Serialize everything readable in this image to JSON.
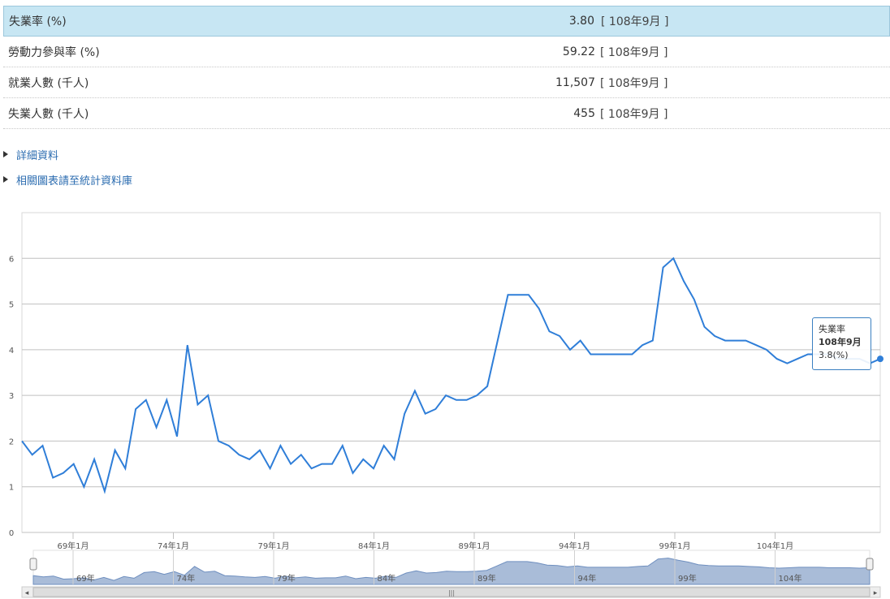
{
  "stats": [
    {
      "label": "失業率 (%)",
      "value": "3.80",
      "period": "[ 108年9月 ]",
      "highlight": true
    },
    {
      "label": "勞動力參與率 (%)",
      "value": "59.22",
      "period": "[ 108年9月 ]",
      "highlight": false
    },
    {
      "label": "就業人數 (千人)",
      "value": "11,507",
      "period": "[ 108年9月 ]",
      "highlight": false
    },
    {
      "label": "失業人數 (千人)",
      "value": "455",
      "period": "[ 108年9月 ]",
      "highlight": false
    }
  ],
  "links": [
    {
      "label": "詳細資料"
    },
    {
      "label": "相關圖表請至統計資料庫"
    }
  ],
  "tooltip": {
    "series": "失業率",
    "period": "108年9月",
    "value": "3.8(%)"
  },
  "colors": {
    "line": "#2f7ed8",
    "navigator_fill": "#a9bcd8",
    "highlight": "#c7e6f3"
  },
  "chart_data": {
    "type": "line",
    "ylim": [
      0,
      7
    ],
    "yticks": [
      "0",
      "1",
      "2",
      "3",
      "4",
      "5",
      "6"
    ],
    "xticks": [
      "69年1月",
      "74年1月",
      "79年1月",
      "84年1月",
      "89年1月",
      "94年1月",
      "99年1月",
      "104年1月"
    ],
    "navigator_ticks": [
      "69年",
      "74年",
      "79年",
      "84年",
      "89年",
      "94年",
      "99年",
      "104年"
    ],
    "x": [
      "67年1月",
      "67年7月",
      "68年1月",
      "68年7月",
      "69年1月",
      "69年7月",
      "70年1月",
      "70年7月",
      "71年1月",
      "71年7月",
      "72年1月",
      "72年7月",
      "73年1月",
      "73年7月",
      "74年1月",
      "74年7月",
      "75年1月",
      "75年7月",
      "76年1月",
      "76年7月",
      "77年1月",
      "77年7月",
      "78年1月",
      "78年7月",
      "79年1月",
      "79年7月",
      "80年1月",
      "80年7月",
      "81年1月",
      "81年7月",
      "82年1月",
      "82年7月",
      "83年1月",
      "83年7月",
      "84年1月",
      "84年7月",
      "85年1月",
      "85年7月",
      "86年1月",
      "86年7月",
      "87年1月",
      "87年7月",
      "88年1月",
      "88年7月",
      "89年1月",
      "89年7月",
      "90年1月",
      "90年7月",
      "91年1月",
      "91年7月",
      "92年1月",
      "92年7月",
      "93年1月",
      "93年7月",
      "94年1月",
      "94年7月",
      "95年1月",
      "95年7月",
      "96年1月",
      "96年7月",
      "97年1月",
      "97年7月",
      "98年1月",
      "98年7月",
      "99年1月",
      "99年7月",
      "100年1月",
      "100年7月",
      "101年1月",
      "101年7月",
      "102年1月",
      "102年7月",
      "103年1月",
      "103年7月",
      "104年1月",
      "104年7月",
      "105年1月",
      "105年7月",
      "106年1月",
      "106年7月",
      "107年1月",
      "107年7月",
      "108年1月",
      "108年9月"
    ],
    "series": [
      {
        "values": [
          2.0,
          1.7,
          1.9,
          1.2,
          1.3,
          1.5,
          1.0,
          1.6,
          0.9,
          1.8,
          1.4,
          2.7,
          2.9,
          2.3,
          2.9,
          2.1,
          4.1,
          2.8,
          3.0,
          2.0,
          1.9,
          1.7,
          1.6,
          1.8,
          1.4,
          1.9,
          1.5,
          1.7,
          1.4,
          1.5,
          1.5,
          1.9,
          1.3,
          1.6,
          1.4,
          1.9,
          1.6,
          2.6,
          3.1,
          2.6,
          2.7,
          3.0,
          2.9,
          2.9,
          3.0,
          3.2,
          4.2,
          5.2,
          5.2,
          5.2,
          4.9,
          4.4,
          4.3,
          4.0,
          4.2,
          3.9,
          3.9,
          3.9,
          3.9,
          3.9,
          4.1,
          4.2,
          5.8,
          6.0,
          5.5,
          5.1,
          4.5,
          4.3,
          4.2,
          4.2,
          4.2,
          4.1,
          4.0,
          3.8,
          3.7,
          3.8,
          3.9,
          3.9,
          3.9,
          3.8,
          3.8,
          3.8,
          3.7,
          3.8
        ]
      }
    ]
  }
}
